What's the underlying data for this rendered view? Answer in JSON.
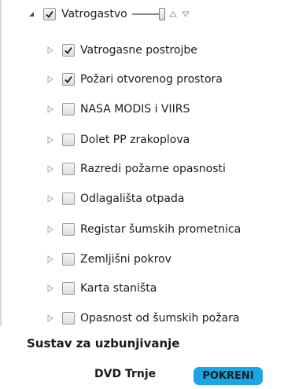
{
  "layers": {
    "root": {
      "label": "Vatrogastvo",
      "checked": true,
      "expanded": true,
      "opacity_level": 1.0
    },
    "children": [
      {
        "label": "Vatrogasne postrojbe",
        "checked": true
      },
      {
        "label": "Požari otvorenog prostora",
        "checked": true
      },
      {
        "label": "NASA MODIS i VIIRS",
        "checked": false
      },
      {
        "label": "Dolet PP zrakoplova",
        "checked": false
      },
      {
        "label": "Razredi požarne opasnosti",
        "checked": false
      },
      {
        "label": "Odlagališta otpada",
        "checked": false
      },
      {
        "label": "Registar šumskih prometnica",
        "checked": false
      },
      {
        "label": "Zemljišni pokrov",
        "checked": false
      },
      {
        "label": "Karta staništa",
        "checked": false
      },
      {
        "label": "Opasnost od šumskih požara",
        "checked": false
      }
    ]
  },
  "alert_system": {
    "title": "Sustav za uzbunjivanje",
    "station": "DVD Trnje",
    "start_label": "POKRENI"
  },
  "icons": {
    "expand": "triangle-right-icon",
    "collapse": "triangle-down-filled-icon",
    "move_up": "arrow-up-icon",
    "move_down": "arrow-down-icon",
    "check": "checkmark-icon"
  },
  "colors": {
    "start_button": "#19a6e2",
    "checkmark": "#1a1a1a",
    "expander": "#a8a8a8"
  }
}
